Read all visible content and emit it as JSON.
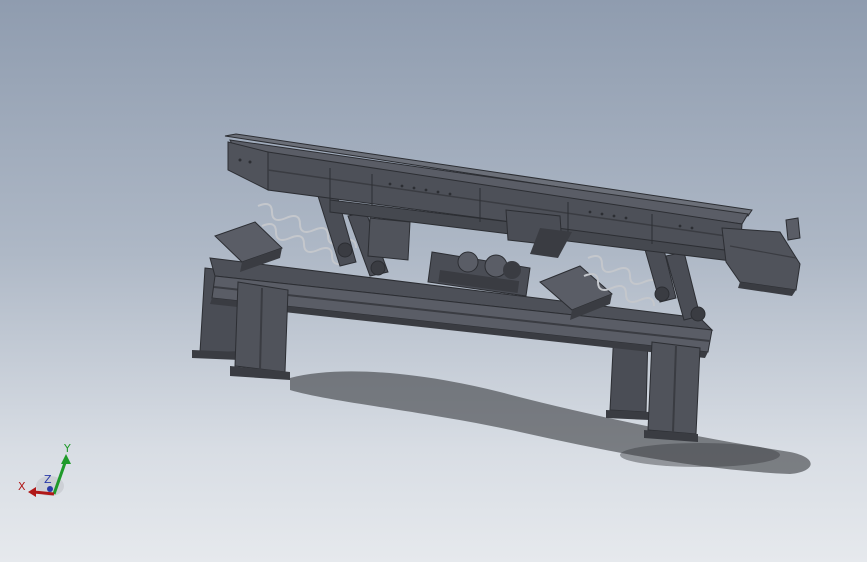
{
  "viewport": {
    "background_top": "#8f9caf",
    "background_bottom": "#e6e9ed"
  },
  "model": {
    "color_body": "#50535b",
    "color_dark": "#3a3c42",
    "color_light": "#6b6f78",
    "color_spring": "#b9bcc2"
  },
  "triad": {
    "x_label": "X",
    "y_label": "Y",
    "z_label": "Z",
    "x_color": "#b01818",
    "y_color": "#1f9a2a",
    "z_color": "#2a3aa8"
  }
}
